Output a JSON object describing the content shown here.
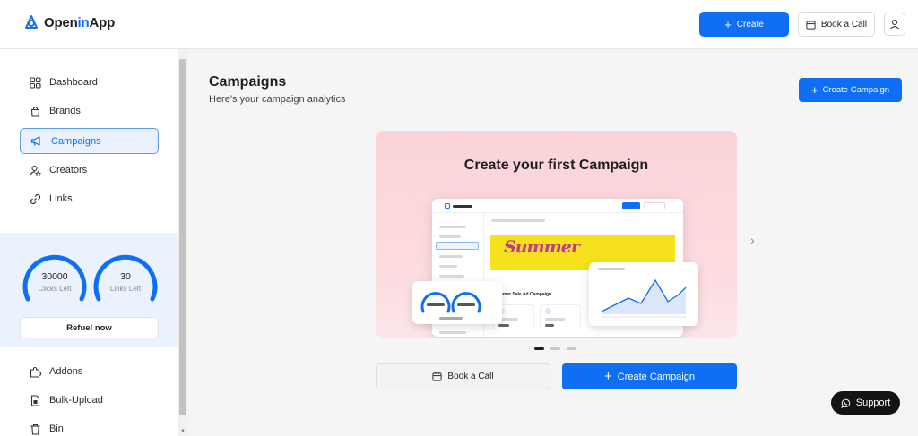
{
  "app": {
    "brand_prefix": "Open",
    "brand_accent": "in",
    "brand_suffix": "App",
    "accent_color": "#0e6ff5"
  },
  "header": {
    "create_label": "Create",
    "book_call_label": "Book a Call"
  },
  "sidebar": {
    "items": [
      {
        "label": "Dashboard",
        "icon": "grid-icon"
      },
      {
        "label": "Brands",
        "icon": "shopping-bag-icon"
      },
      {
        "label": "Campaigns",
        "icon": "megaphone-icon",
        "active": true
      },
      {
        "label": "Creators",
        "icon": "user-star-icon"
      },
      {
        "label": "Links",
        "icon": "link-icon"
      }
    ],
    "credits": {
      "clicks_value": "30000",
      "clicks_label": "Clicks Left",
      "clicks_fill": 1.0,
      "links_value": "30",
      "links_label": "Links Left",
      "links_fill": 1.0,
      "refuel_label": "Refuel now"
    },
    "bottom_items": [
      {
        "label": "Addons",
        "icon": "puzzle-icon"
      },
      {
        "label": "Bulk-Upload",
        "icon": "file-upload-icon"
      },
      {
        "label": "Bin",
        "icon": "trash-icon"
      }
    ]
  },
  "main": {
    "title": "Campaigns",
    "subtitle": "Here's your campaign analytics",
    "create_campaign_label": "Create Campaign",
    "hero": {
      "title": "Create your first Campaign",
      "slides": 3,
      "active_slide": 1
    },
    "book_call_label": "Book a Call",
    "create_campaign_main_label": "Create Campaign"
  },
  "support": {
    "label": "Support"
  }
}
